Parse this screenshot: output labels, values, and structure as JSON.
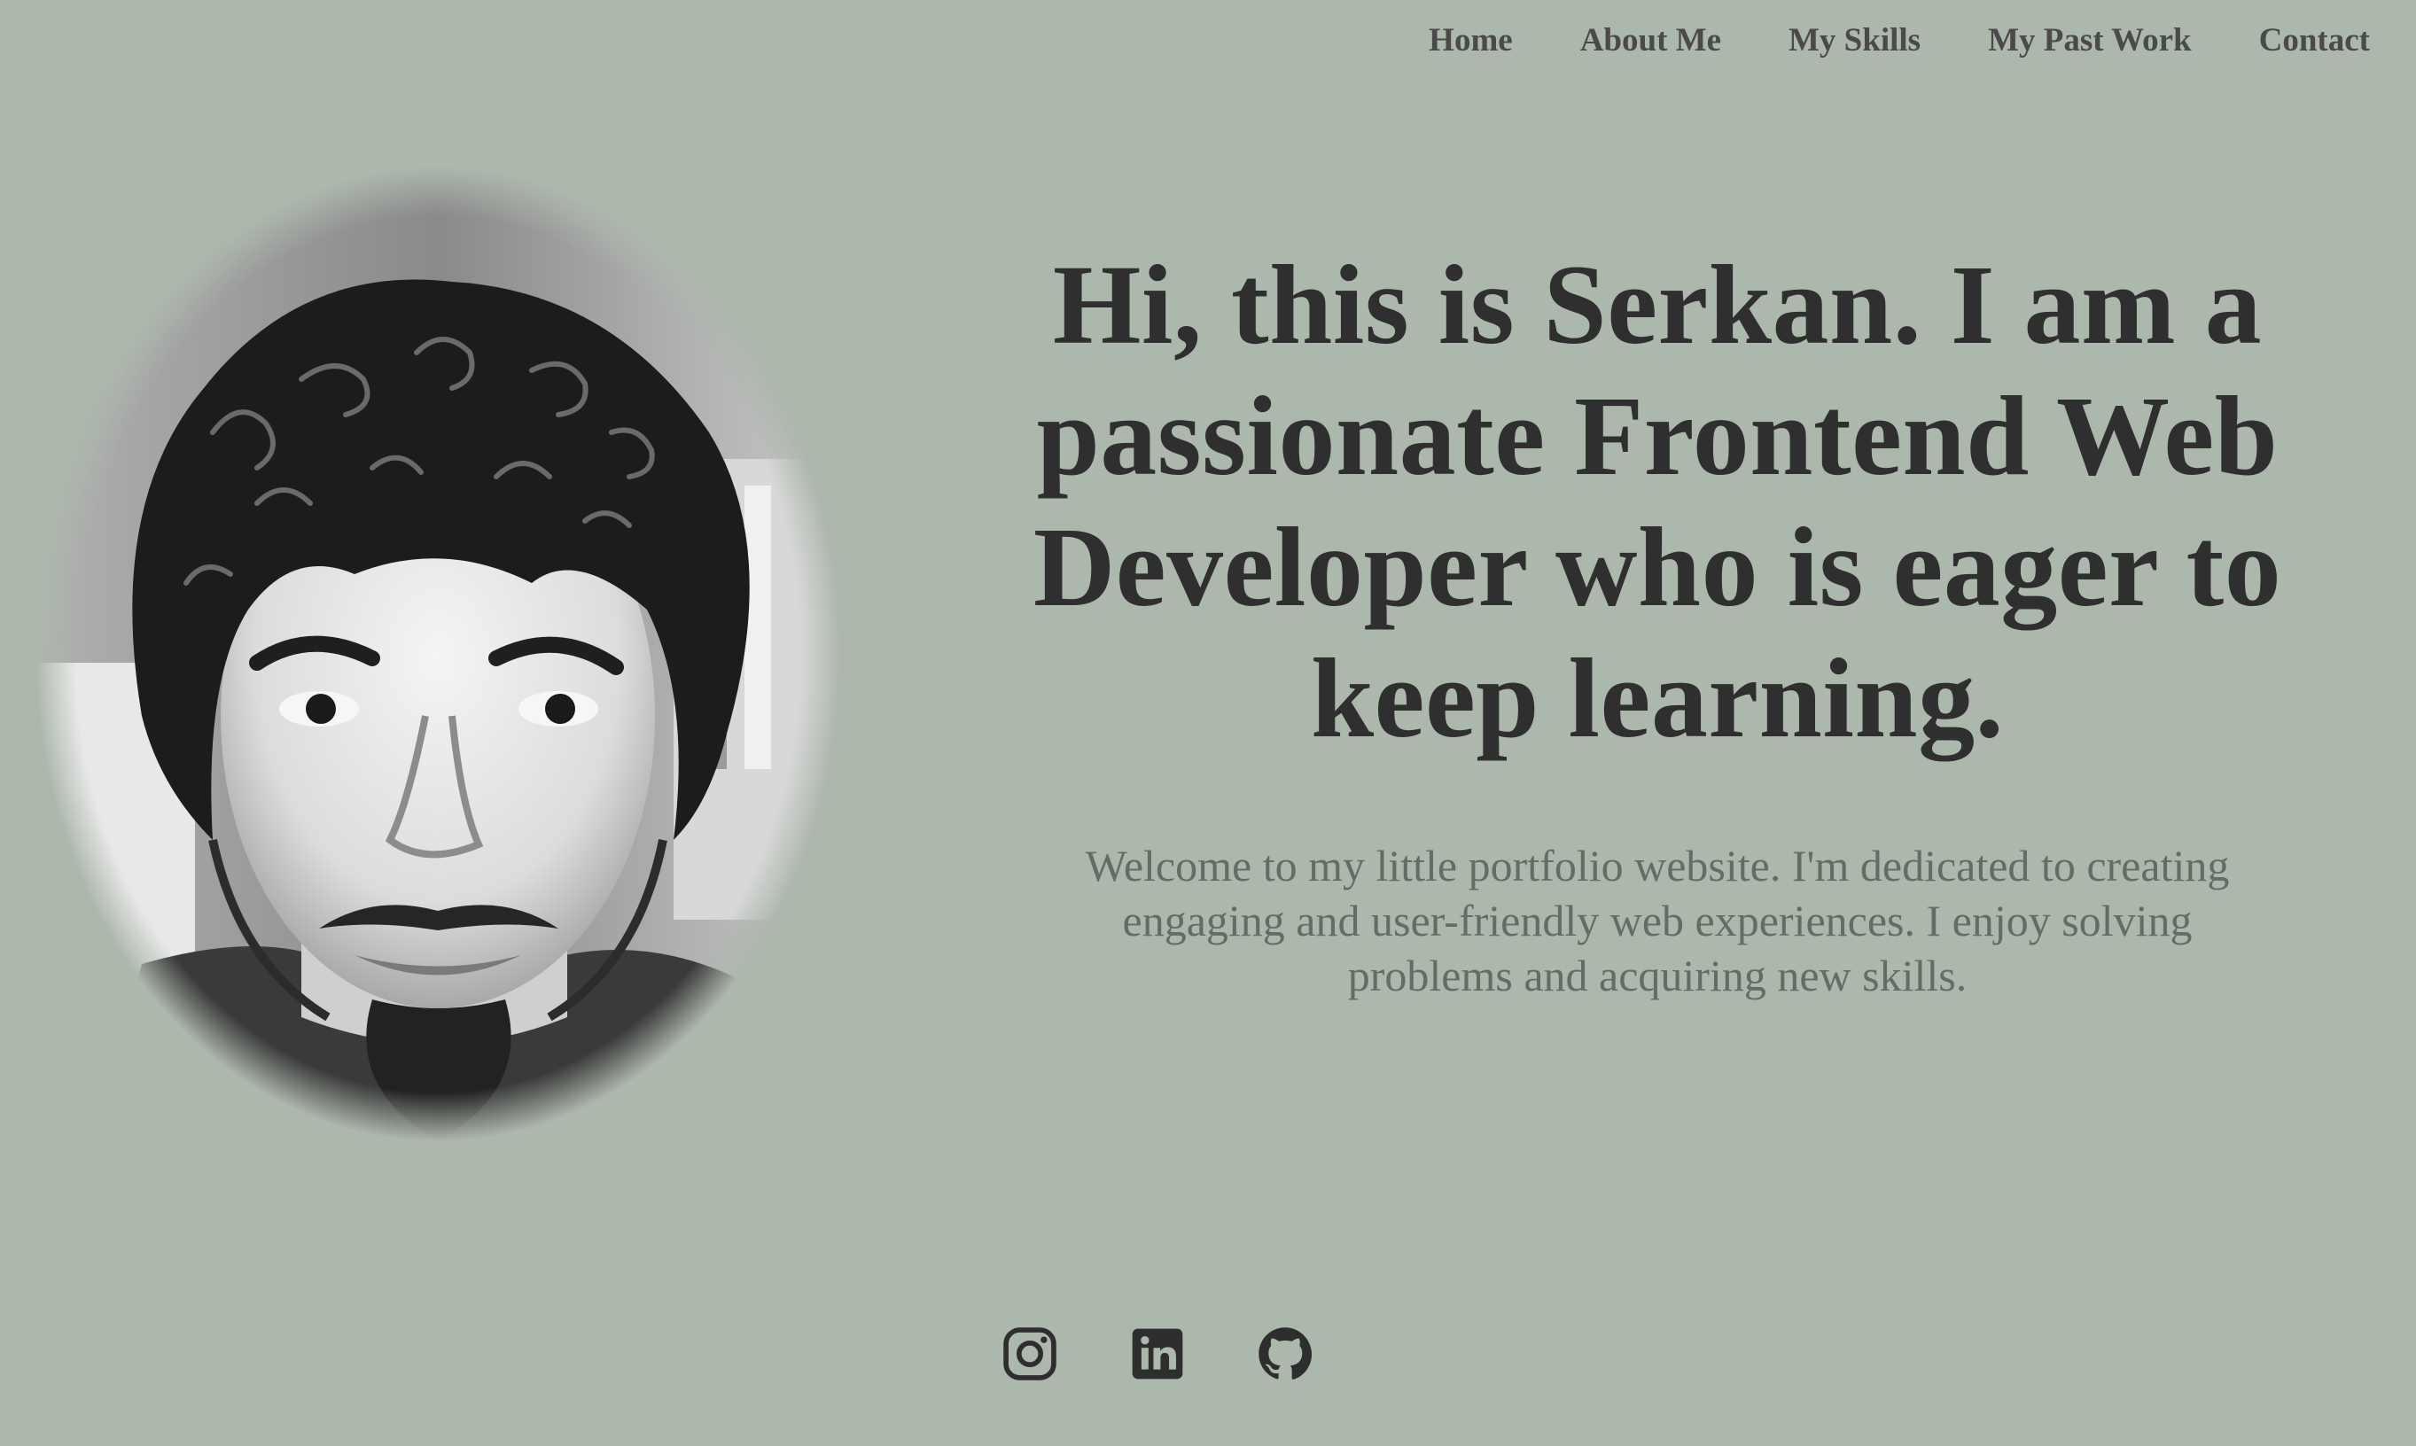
{
  "nav": {
    "items": [
      {
        "label": "Home"
      },
      {
        "label": "About Me"
      },
      {
        "label": "My Skills"
      },
      {
        "label": "My Past Work"
      },
      {
        "label": "Contact"
      }
    ]
  },
  "hero": {
    "heading": "Hi, this is Serkan. I am a passionate Frontend Web Developer who is eager to keep learning.",
    "intro": "Welcome to my little portfolio website. I'm dedicated to creating engaging and user-friendly web experiences. I enjoy solving problems and acquiring new skills."
  },
  "portrait": {
    "alt": "Serkan"
  },
  "social": {
    "icons": [
      "instagram-icon",
      "linkedin-icon",
      "github-icon"
    ]
  },
  "colors": {
    "background": "#adb8ad",
    "heading": "#2f2f2f",
    "body_text": "#666b66",
    "nav_text": "#4a4a4a",
    "icons": "#2e2e2e"
  }
}
